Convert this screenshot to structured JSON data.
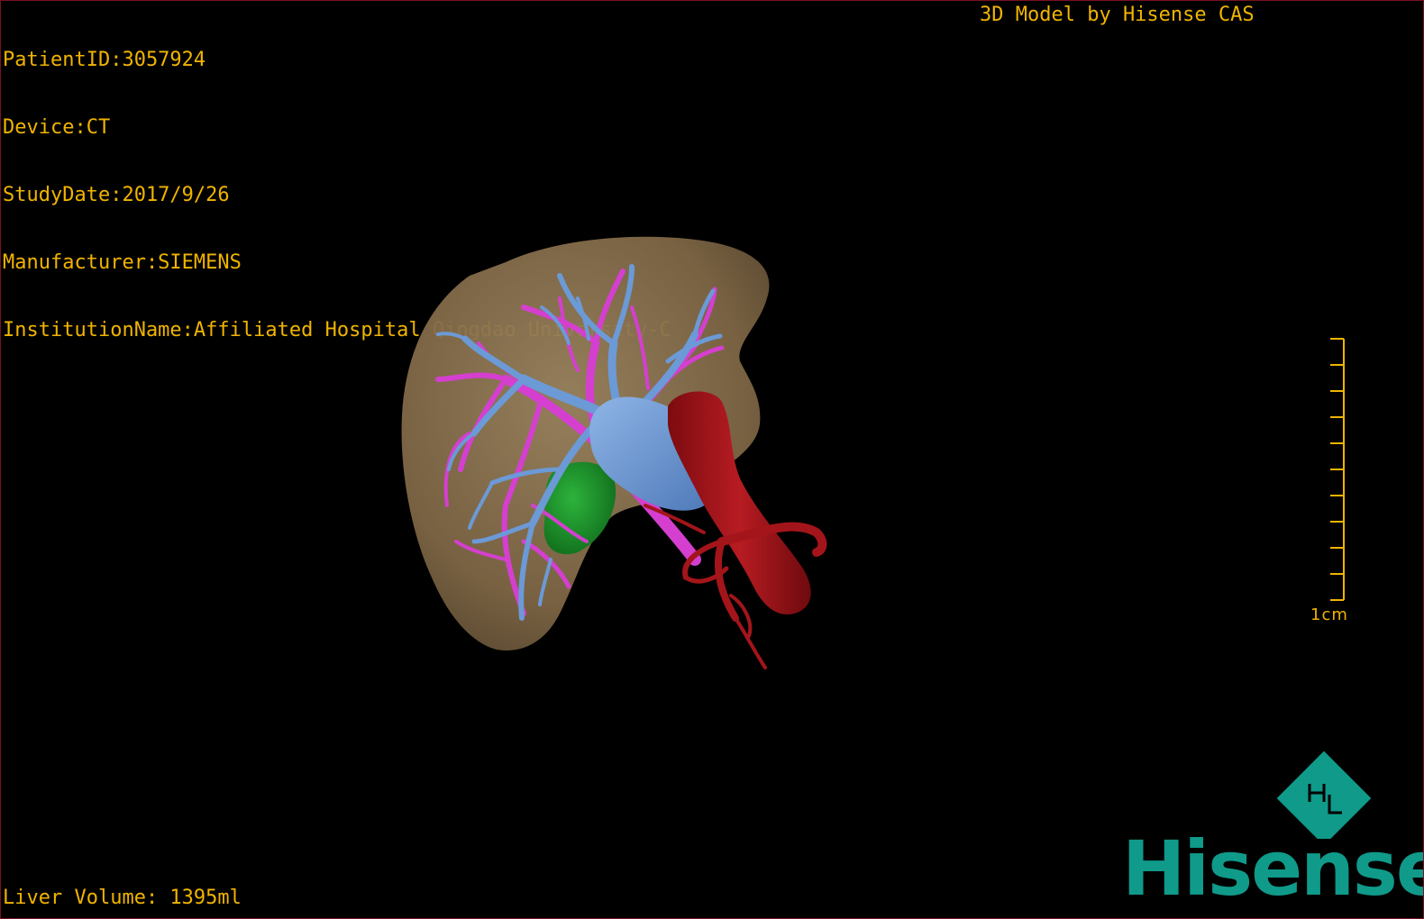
{
  "metadata": {
    "patient_id": "PatientID:3057924",
    "device": "Device:CT",
    "study_date": "StudyDate:2017/9/26",
    "manufacturer": "Manufacturer:SIEMENS",
    "institution": "InstitutionName:Affiliated Hospital Qingdao University-C"
  },
  "credit": "3D Model by Hisense CAS",
  "liver_volume": "Liver Volume: 1395ml",
  "scale_bar": {
    "label": "1cm"
  },
  "brand": {
    "name": "Hisense",
    "color": "#0f9a8a"
  },
  "colors": {
    "overlay_text": "#f0b400",
    "liver": "#8a7150",
    "hepatic_vein": "#6b9ad6",
    "portal_vein": "#d53fd0",
    "artery": "#a3151a",
    "gallbladder": "#1a8c2a"
  }
}
